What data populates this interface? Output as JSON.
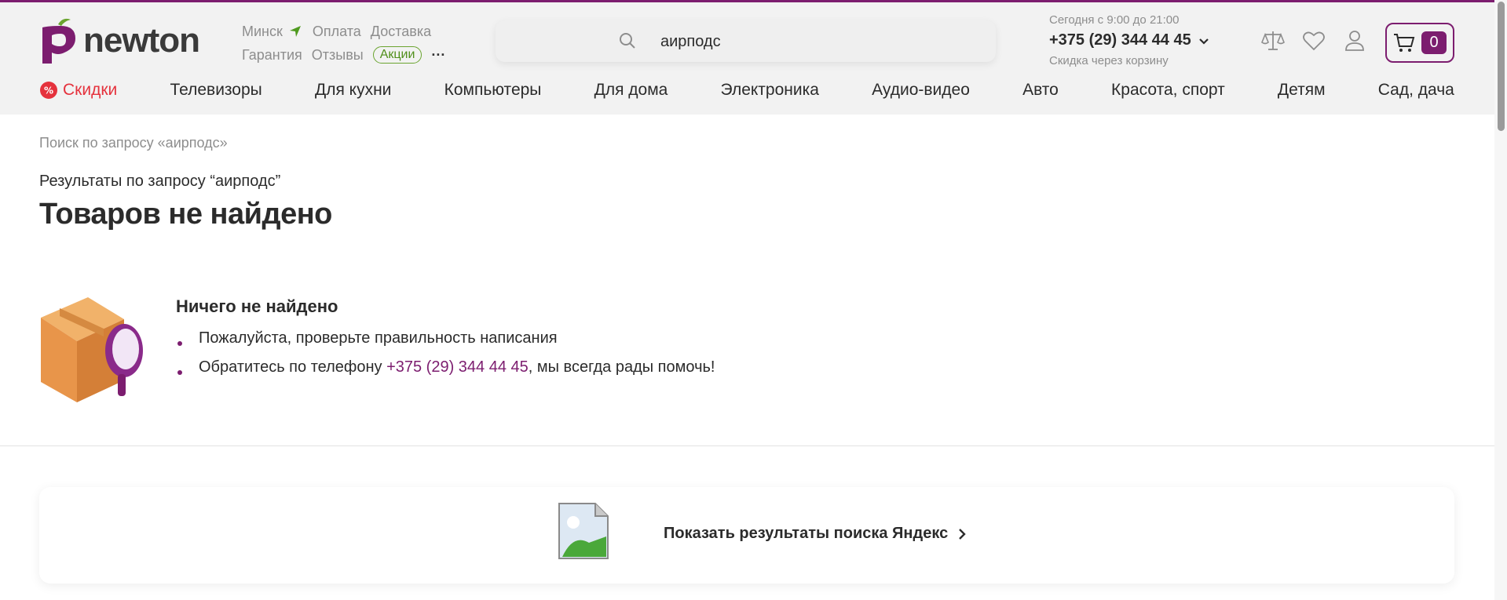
{
  "header": {
    "logo_text": "newton",
    "links_row1": [
      "Минск",
      "Оплата",
      "Доставка"
    ],
    "links_row2": [
      "Гарантия",
      "Отзывы"
    ],
    "promo_label": "Акции",
    "more_label": "···",
    "search_value": "аирподс",
    "hours": "Сегодня с 9:00 до 21:00",
    "phone": "+375 (29) 344 44 45",
    "discount_note": "Скидка через корзину",
    "cart_count": "0"
  },
  "nav": {
    "sale_label": "Скидки",
    "categories": [
      "Телевизоры",
      "Для кухни",
      "Компьютеры",
      "Для дома",
      "Электроника",
      "Аудио-видео",
      "Авто",
      "Красота, спорт",
      "Детям",
      "Сад, дача"
    ]
  },
  "main": {
    "breadcrumb": "Поиск по запросу «аирподс»",
    "results_label": "Результаты по запросу “аирподс”",
    "title": "Товаров не найдено",
    "not_found_title": "Ничего не найдено",
    "tip1": "Пожалуйста, проверьте правильность написания",
    "tip2_prefix": "Обратитесь по телефону ",
    "tip2_phone": "+375 (29) 344 44 45",
    "tip2_suffix": ", мы всегда рады помочь!",
    "yandex_link": "Показать результаты поиска Яндекс"
  },
  "colors": {
    "brand": "#7c1d6f",
    "sale": "#e5323d",
    "promo": "#6aa42f"
  }
}
